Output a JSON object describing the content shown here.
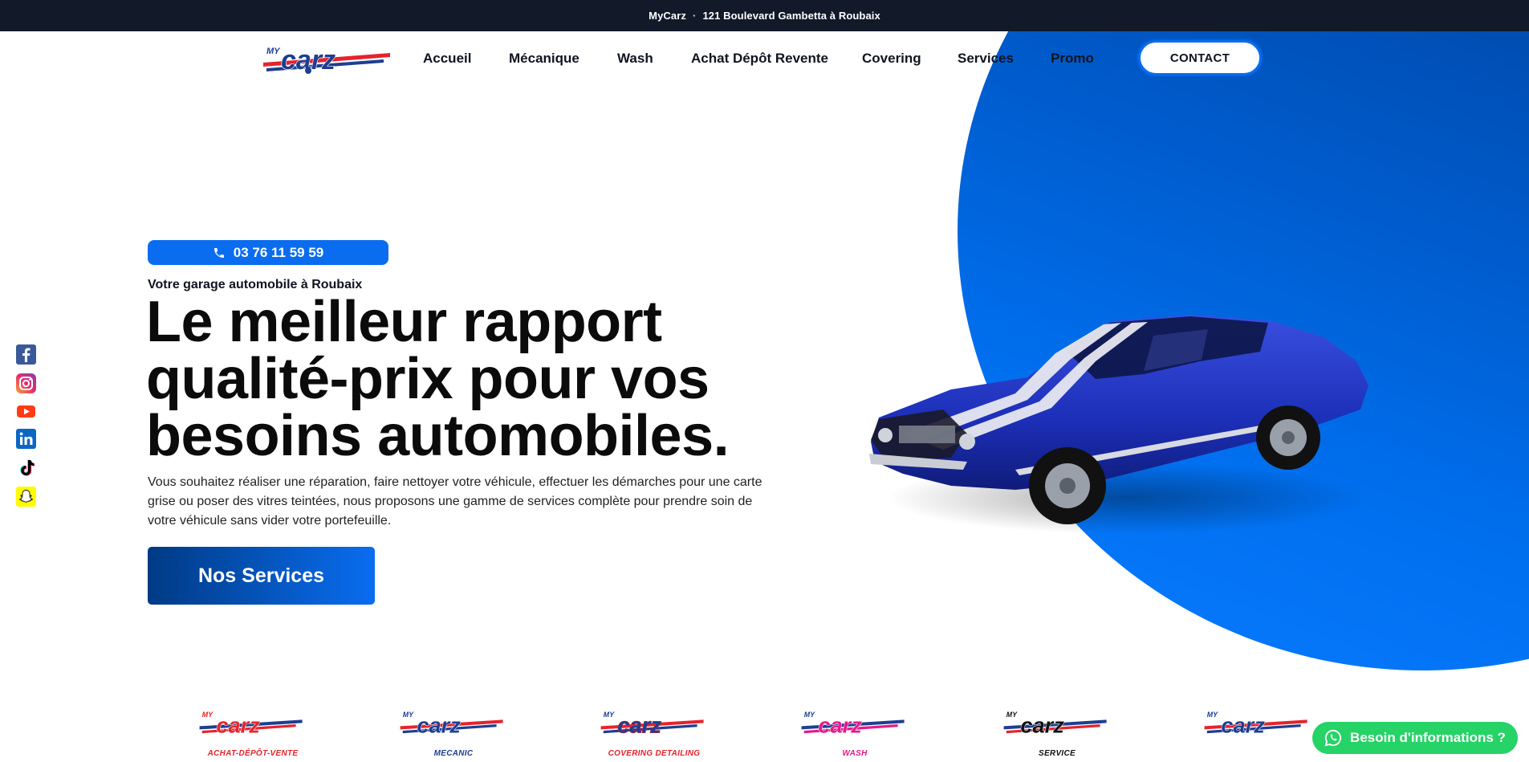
{
  "topbar": {
    "brand": "MyCarz",
    "separator": "·",
    "address": "121 Boulevard Gambetta à Roubaix"
  },
  "logo": {
    "name": "MyCarz"
  },
  "nav": {
    "items": [
      "Accueil",
      "Mécanique",
      "Wash",
      "Achat Dépôt Revente",
      "Covering",
      "Services",
      "Promo"
    ],
    "contact_label": "CONTACT"
  },
  "hero": {
    "phone": "03 76 11 59 59",
    "tagline": "Votre garage automobile à Roubaix",
    "headline": "Le meilleur rapport qualité-prix pour vos besoins automobiles.",
    "description": "Vous souhaitez réaliser une réparation, faire nettoyer votre véhicule, effectuer les démarches pour une carte grise ou poser des vitres teintées, nous proposons une gamme de services complète pour prendre soin de votre véhicule sans vider votre portefeuille.",
    "cta_label": "Nos Services"
  },
  "social": [
    "facebook-icon",
    "instagram-icon",
    "youtube-icon",
    "linkedin-icon",
    "tiktok-icon",
    "snapchat-icon"
  ],
  "brands": [
    {
      "name": "achat-depot-vente",
      "tag": "ACHAT-DÉPÔT-VENTE",
      "color": "#e5232d"
    },
    {
      "name": "mecanic",
      "tag": "MECANIC",
      "color": "#1d3e91"
    },
    {
      "name": "covering",
      "tag": "COVERING DETAILING",
      "color": "#e5232d"
    },
    {
      "name": "wash",
      "tag": "WASH",
      "color": "#e5198a"
    },
    {
      "name": "service",
      "tag": "SERVICE",
      "color": "#111111"
    },
    {
      "name": "mycarz",
      "tag": "",
      "color": "#1d3e91"
    }
  ],
  "whatsapp": {
    "label": "Besoin d'informations ?"
  },
  "colors": {
    "primary": "#0a6df0",
    "dark_navy": "#121a2a",
    "whatsapp": "#25d366",
    "brand_red": "#e5232d"
  }
}
